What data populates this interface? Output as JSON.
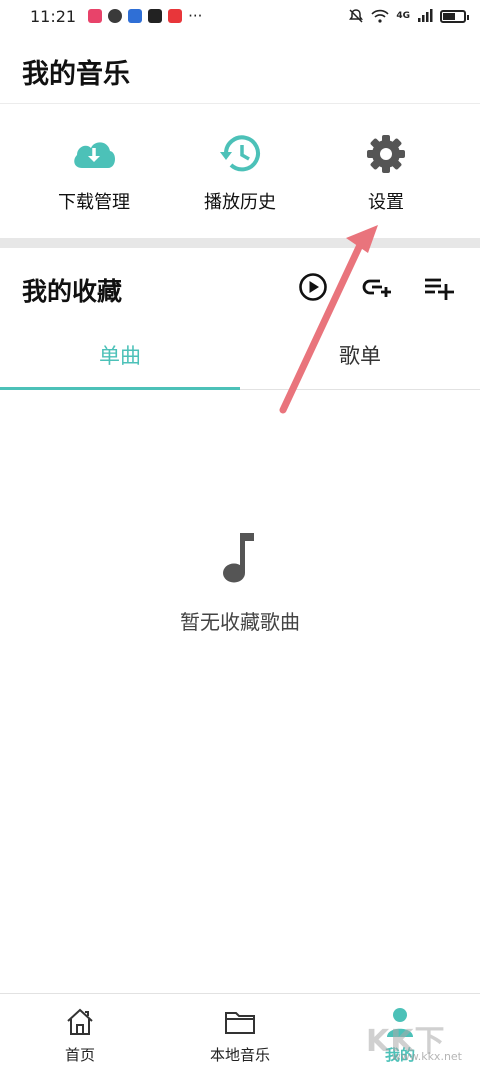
{
  "status_bar": {
    "time": "11:21",
    "more": "···",
    "network": "4G"
  },
  "header": {
    "title": "我的音乐"
  },
  "quick_actions": [
    {
      "label": "下载管理",
      "icon": "cloud-download-icon"
    },
    {
      "label": "播放历史",
      "icon": "history-icon"
    },
    {
      "label": "设置",
      "icon": "gear-icon"
    }
  ],
  "favorites": {
    "title": "我的收藏",
    "actions": [
      "play-all-icon",
      "link-add-icon",
      "playlist-add-icon"
    ]
  },
  "tabs": [
    {
      "label": "单曲",
      "active": true
    },
    {
      "label": "歌单",
      "active": false
    }
  ],
  "empty_state": {
    "text": "暂无收藏歌曲",
    "icon": "music-note-icon"
  },
  "bottom_nav": [
    {
      "label": "首页",
      "icon": "home-icon",
      "active": false
    },
    {
      "label": "本地音乐",
      "icon": "folder-icon",
      "active": false
    },
    {
      "label": "我的",
      "icon": "user-icon",
      "active": true
    }
  ],
  "watermark": {
    "text": "KK下载",
    "url": "www.kkx.net"
  },
  "colors": {
    "accent": "#4cc1b8",
    "arrow": "#e9747c",
    "icon_gray": "#555555"
  },
  "battery_level": 0.6
}
